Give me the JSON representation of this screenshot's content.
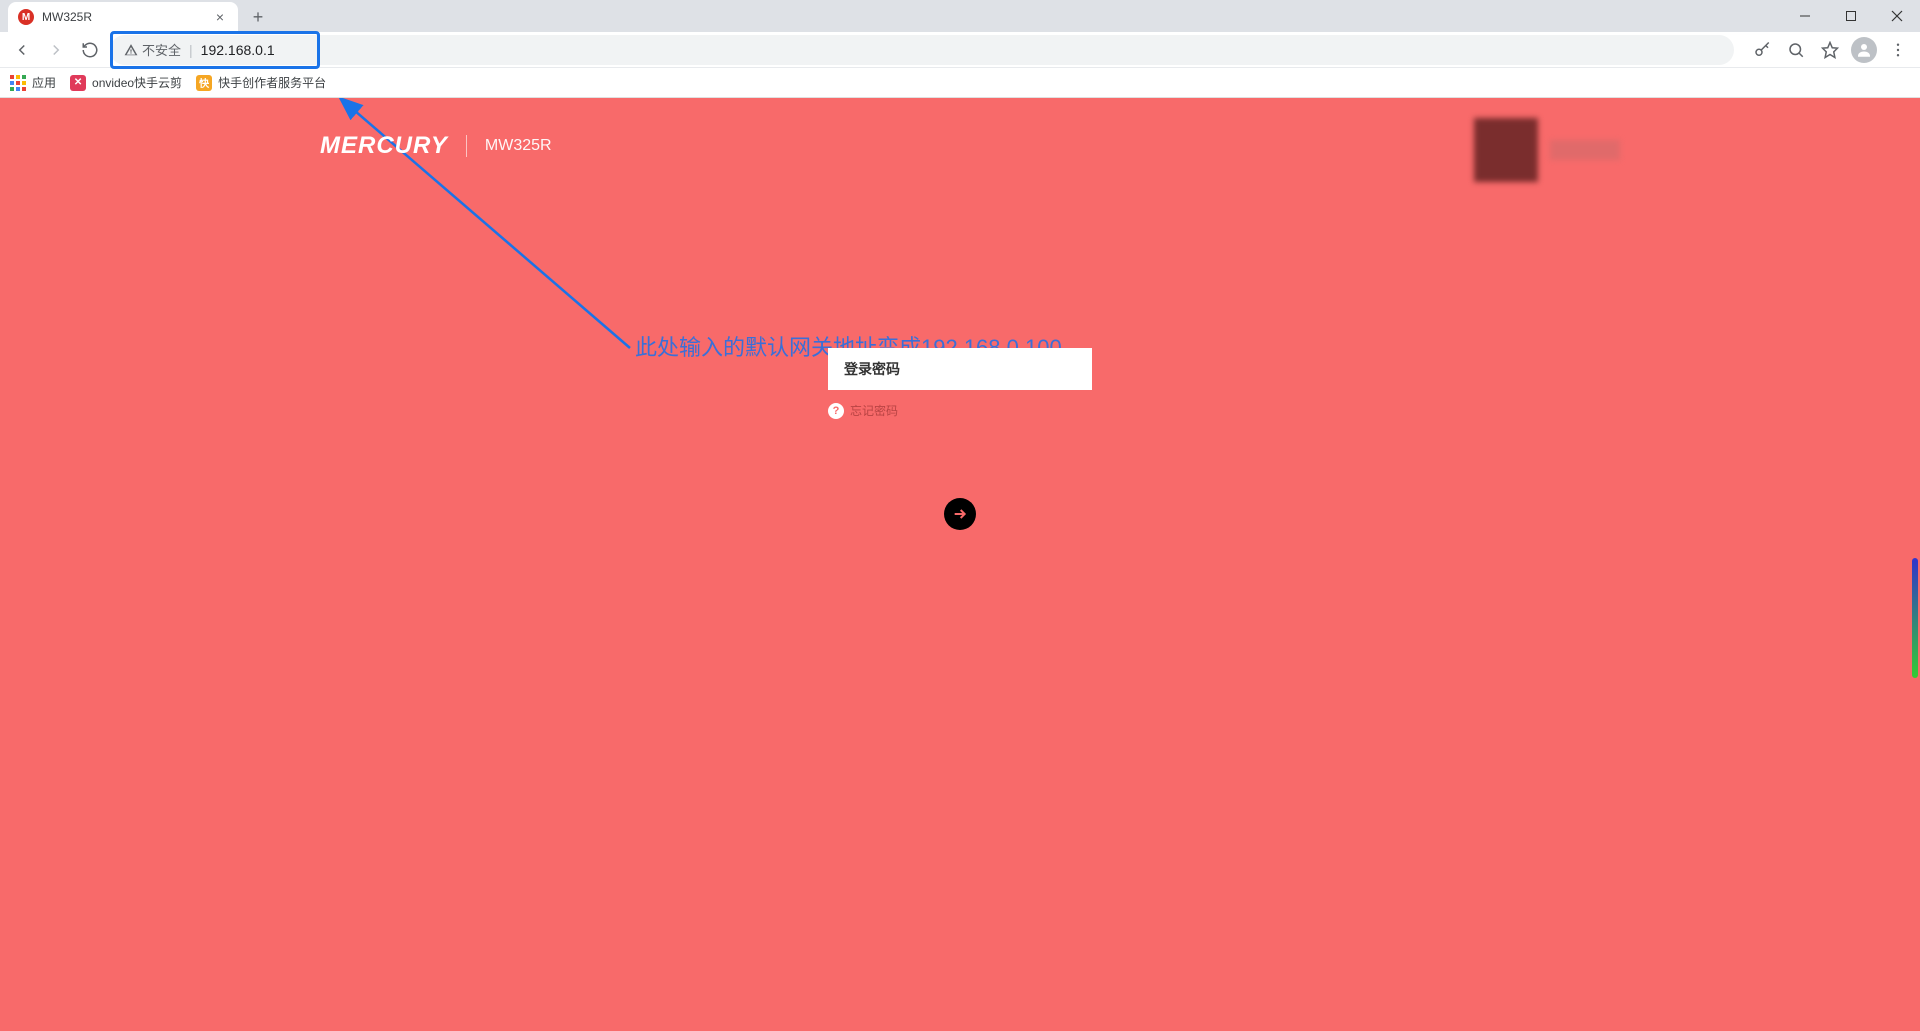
{
  "browser": {
    "tab": {
      "favicon_letter": "M",
      "title": "MW325R"
    },
    "address": {
      "not_secure_label": "不安全",
      "url": "192.168.0.1"
    },
    "bookmarks": {
      "apps_label": "应用",
      "items": [
        {
          "label": "onvideo快手云剪",
          "color": "#e03a5a"
        },
        {
          "label": "快手创作者服务平台",
          "color": "#f5a623"
        }
      ]
    }
  },
  "annotation": {
    "text": "此处输入的默认网关地址变成192.168.0.100"
  },
  "router_page": {
    "brand": "MERCURY",
    "model": "MW325R",
    "password_placeholder": "登录密码",
    "forgot_label": "忘记密码"
  }
}
